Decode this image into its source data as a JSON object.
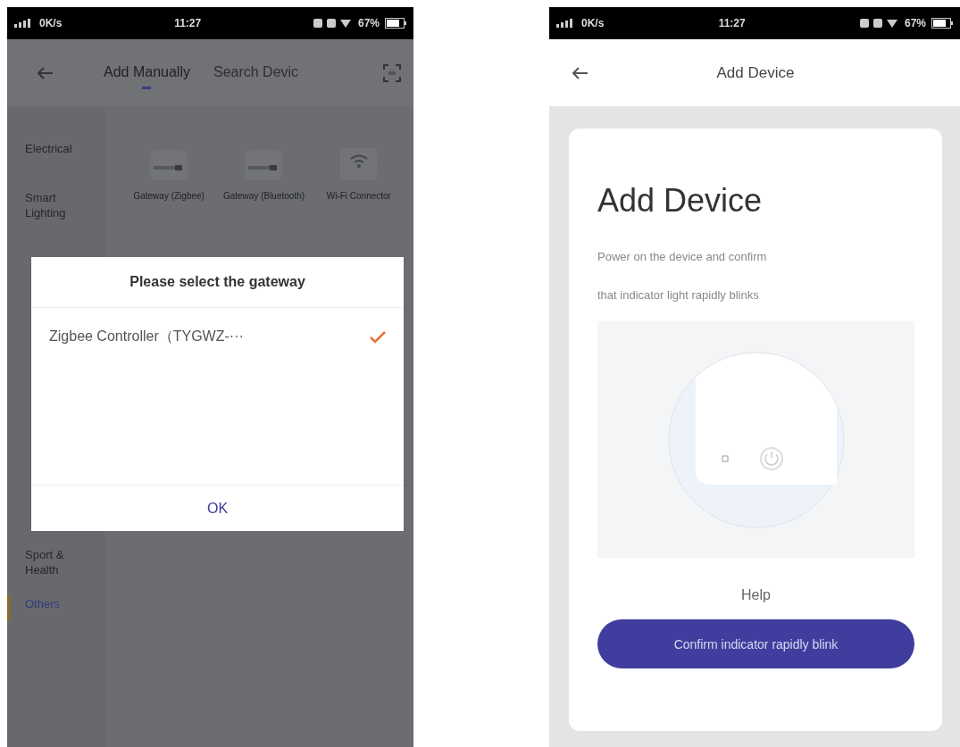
{
  "left_screen": {
    "status_bar": {
      "network": "0K/s",
      "time": "11:27",
      "battery": "67%"
    },
    "tabs": [
      {
        "label": "Add Manually",
        "selected": true
      },
      {
        "label": "Search Devic",
        "selected": false
      }
    ],
    "categories": [
      {
        "label": "Electrical",
        "selected": false
      },
      {
        "label": "Smart Lighting",
        "selected": false
      },
      {
        "label": "Sport & Health",
        "selected": false
      },
      {
        "label": "Others",
        "selected": true
      }
    ],
    "devices": [
      {
        "label": "Gateway (Zigbee)",
        "kind": "gateway"
      },
      {
        "label": "Gateway (Bluetooth)",
        "kind": "gateway"
      },
      {
        "label": "Wi-Fi Connector",
        "kind": "wifi"
      }
    ],
    "dialog": {
      "title": "Please select the gateway",
      "options": [
        {
          "label": "Zigbee Controller（TYGWZ-···",
          "checked": true
        }
      ],
      "button": "OK"
    }
  },
  "right_screen": {
    "status_bar": {
      "network": "0K/s",
      "time": "11:27",
      "battery": "67%"
    },
    "header_title": "Add Device",
    "card": {
      "title": "Add Device",
      "description_lines": [
        "Power on the device and confirm",
        "that indicator light rapidly blinks"
      ],
      "help_link": "Help",
      "button": "Confirm indicator rapidly blink"
    }
  }
}
